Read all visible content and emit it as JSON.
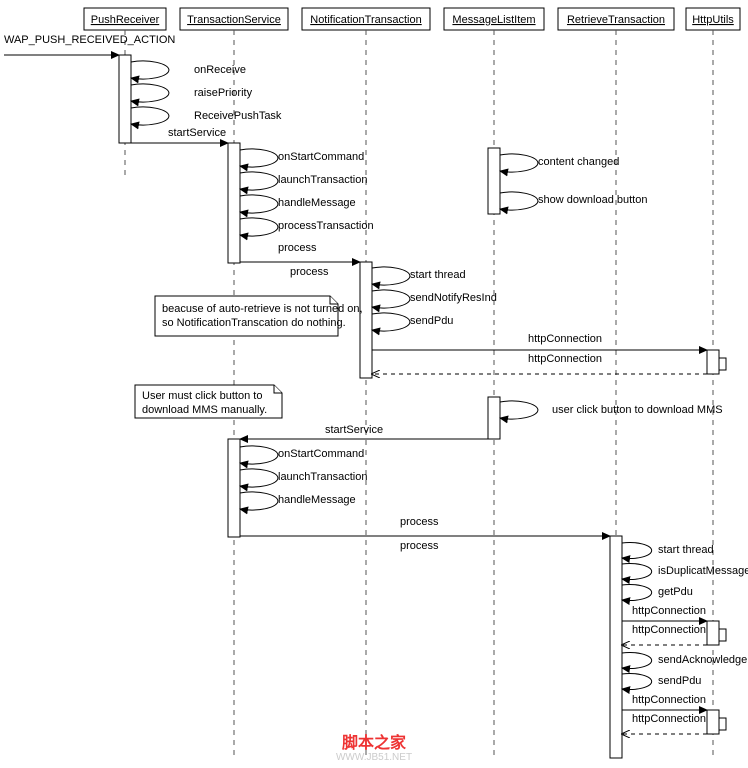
{
  "actors": {
    "a1": "PushReceiver",
    "a2": "TransactionService",
    "a3": "NotificationTransaction",
    "a4": "MessageListItem",
    "a5": "RetrieveTransaction",
    "a6": "HttpUtils"
  },
  "trigger": "WAP_PUSH_RECEIVED_ACTION",
  "self1": {
    "m1": "onReceive",
    "m2": "raisePriority",
    "m3": "ReceivePushTask"
  },
  "msgs": {
    "startService1": "startService",
    "onStartCommand1": "onStartCommand",
    "launchTransaction1": "launchTransaction",
    "handleMessage1": "handleMessage",
    "processTransaction": "processTransaction",
    "contentChanged": "content changed",
    "showDownload": "show download button",
    "process1": "process",
    "process2": "process",
    "startThread1": "start thread",
    "sendNotifyResInd": "sendNotifyResInd",
    "sendPdu1": "sendPdu",
    "httpConn1": "httpConnection",
    "httpConn2": "httpConnection",
    "userClick": "user click button to download MMS",
    "startService2": "startService",
    "onStartCommand2": "onStartCommand",
    "launchTransaction2": "launchTransaction",
    "handleMessage2": "handleMessage",
    "process3": "process",
    "process4": "process",
    "startThread2": "start thread",
    "isDup": "isDuplicatMessage",
    "getPdu": "getPdu",
    "httpConn3": "httpConnection",
    "httpConn4": "httpConnection",
    "sendAck": "sendAcknowledgeInd",
    "sendPdu2": "sendPdu",
    "httpConn5": "httpConnection",
    "httpConn6": "httpConnection"
  },
  "notes": {
    "n1a": "beacuse of auto-retrieve is not turned on,",
    "n1b": "so NotificationTranscation do nothing.",
    "n2a": "User must click button to",
    "n2b": "download MMS manually."
  },
  "watermark": {
    "title": "脚本之家",
    "url": "WWW.JB51.NET"
  },
  "chart_data": {
    "type": "sequence-diagram",
    "actors": [
      "PushReceiver",
      "TransactionService",
      "NotificationTransaction",
      "MessageListItem",
      "RetrieveTransaction",
      "HttpUtils"
    ],
    "interactions": [
      {
        "from": "external",
        "to": "PushReceiver",
        "label": "WAP_PUSH_RECEIVED_ACTION"
      },
      {
        "from": "PushReceiver",
        "to": "PushReceiver",
        "label": "onReceive"
      },
      {
        "from": "PushReceiver",
        "to": "PushReceiver",
        "label": "raisePriority"
      },
      {
        "from": "PushReceiver",
        "to": "PushReceiver",
        "label": "ReceivePushTask"
      },
      {
        "from": "PushReceiver",
        "to": "TransactionService",
        "label": "startService"
      },
      {
        "from": "TransactionService",
        "to": "TransactionService",
        "label": "onStartCommand"
      },
      {
        "from": "TransactionService",
        "to": "TransactionService",
        "label": "launchTransaction"
      },
      {
        "from": "TransactionService",
        "to": "TransactionService",
        "label": "handleMessage"
      },
      {
        "from": "TransactionService",
        "to": "TransactionService",
        "label": "processTransaction"
      },
      {
        "from": "MessageListItem",
        "to": "MessageListItem",
        "label": "content changed"
      },
      {
        "from": "MessageListItem",
        "to": "MessageListItem",
        "label": "show download button"
      },
      {
        "from": "TransactionService",
        "to": "NotificationTransaction",
        "label": "process"
      },
      {
        "from": "NotificationTransaction",
        "to": "NotificationTransaction",
        "label": "process"
      },
      {
        "from": "NotificationTransaction",
        "to": "NotificationTransaction",
        "label": "start thread"
      },
      {
        "from": "NotificationTransaction",
        "to": "NotificationTransaction",
        "label": "sendNotifyResInd"
      },
      {
        "from": "NotificationTransaction",
        "to": "NotificationTransaction",
        "label": "sendPdu"
      },
      {
        "from": "NotificationTransaction",
        "to": "HttpUtils",
        "label": "httpConnection"
      },
      {
        "from": "HttpUtils",
        "to": "HttpUtils",
        "label": "httpConnection"
      },
      {
        "from": "HttpUtils",
        "to": "NotificationTransaction",
        "label": "return",
        "dashed": true
      },
      {
        "note": "beacuse of auto-retrieve is not turned on, so NotificationTranscation do nothing."
      },
      {
        "note": "User must click button to download MMS manually."
      },
      {
        "from": "MessageListItem",
        "to": "MessageListItem",
        "label": "user click button to download MMS"
      },
      {
        "from": "MessageListItem",
        "to": "TransactionService",
        "label": "startService"
      },
      {
        "from": "TransactionService",
        "to": "TransactionService",
        "label": "onStartCommand"
      },
      {
        "from": "TransactionService",
        "to": "TransactionService",
        "label": "launchTransaction"
      },
      {
        "from": "TransactionService",
        "to": "TransactionService",
        "label": "handleMessage"
      },
      {
        "from": "TransactionService",
        "to": "RetrieveTransaction",
        "label": "process"
      },
      {
        "from": "RetrieveTransaction",
        "to": "RetrieveTransaction",
        "label": "process"
      },
      {
        "from": "RetrieveTransaction",
        "to": "RetrieveTransaction",
        "label": "start thread"
      },
      {
        "from": "RetrieveTransaction",
        "to": "RetrieveTransaction",
        "label": "isDuplicatMessage"
      },
      {
        "from": "RetrieveTransaction",
        "to": "RetrieveTransaction",
        "label": "getPdu"
      },
      {
        "from": "RetrieveTransaction",
        "to": "HttpUtils",
        "label": "httpConnection"
      },
      {
        "from": "HttpUtils",
        "to": "HttpUtils",
        "label": "httpConnection"
      },
      {
        "from": "HttpUtils",
        "to": "RetrieveTransaction",
        "label": "return",
        "dashed": true
      },
      {
        "from": "RetrieveTransaction",
        "to": "RetrieveTransaction",
        "label": "sendAcknowledgeInd"
      },
      {
        "from": "RetrieveTransaction",
        "to": "RetrieveTransaction",
        "label": "sendPdu"
      },
      {
        "from": "RetrieveTransaction",
        "to": "HttpUtils",
        "label": "httpConnection"
      },
      {
        "from": "HttpUtils",
        "to": "HttpUtils",
        "label": "httpConnection"
      },
      {
        "from": "HttpUtils",
        "to": "RetrieveTransaction",
        "label": "return",
        "dashed": true
      }
    ]
  }
}
